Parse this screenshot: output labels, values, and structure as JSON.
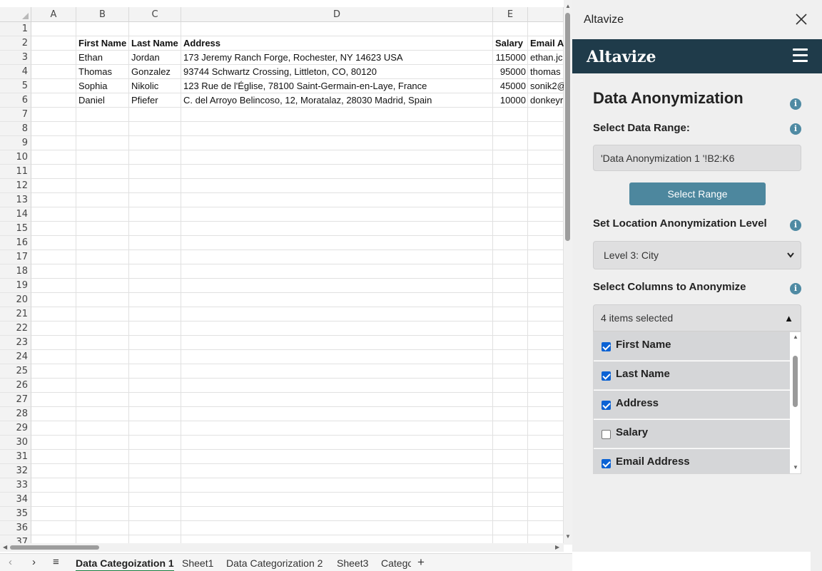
{
  "spreadsheet": {
    "corner": "",
    "columns": [
      "A",
      "B",
      "C",
      "D",
      "E"
    ],
    "rows": [
      "1",
      "2",
      "3",
      "4",
      "5",
      "6",
      "7",
      "8",
      "9",
      "10",
      "11",
      "12",
      "13",
      "14",
      "15",
      "16",
      "17",
      "18",
      "19",
      "20",
      "21",
      "22",
      "23",
      "24",
      "25",
      "26",
      "27",
      "28",
      "29",
      "30",
      "31",
      "32",
      "33",
      "34",
      "35",
      "36",
      "37"
    ],
    "header_row": {
      "first_name": "First Name",
      "last_name": "Last Name",
      "address": "Address",
      "salary": "Salary",
      "email": "Email Ad"
    },
    "data_rows": [
      {
        "first": "Ethan",
        "last": "Jordan",
        "address": "173 Jeremy Ranch Forge, Rochester, NY 14623 USA",
        "salary": "115000",
        "email": "ethan.jc"
      },
      {
        "first": "Thomas",
        "last": "Gonzalez",
        "address": "93744 Schwartz Crossing, Littleton, CO, 80120",
        "salary": "95000",
        "email": "thomas"
      },
      {
        "first": "Sophia",
        "last": "Nikolic",
        "address": "123 Rue de l'Église, 78100 Saint-Germain-en-Laye, France",
        "salary": "45000",
        "email": "sonik2@"
      },
      {
        "first": "Daniel",
        "last": "Pfiefer",
        "address": "C. del Arroyo Belincoso, 12, Moratalaz, 28030 Madrid, Spain",
        "salary": "10000",
        "email": "donkeyr"
      }
    ],
    "tabs": {
      "prev": "‹",
      "next": "›",
      "menu": "≡",
      "items": [
        "Data Categoization 1",
        "Sheet1",
        "Data Categorization 2",
        "Sheet3",
        "Catego"
      ],
      "active_index": 0,
      "add": "+"
    }
  },
  "pane": {
    "title": "Altavize",
    "close_icon": "close-icon",
    "brand": "Altavize",
    "heading": "Data Anonymization",
    "select_range_label": "Select Data Range:",
    "range_value": "'Data Anonymization 1 '!B2:K6",
    "select_range_button": "Select Range",
    "location_label": "Set Location Anonymization Level",
    "location_value": "Level 3: City",
    "columns_label": "Select Columns to Anonymize",
    "columns_summary": "4 items selected",
    "columns_toggle": "▲",
    "info_glyph": "i",
    "columns": [
      {
        "label": "First Name",
        "checked": true
      },
      {
        "label": "Last Name",
        "checked": true
      },
      {
        "label": "Address",
        "checked": true
      },
      {
        "label": "Salary",
        "checked": false
      },
      {
        "label": "Email Address",
        "checked": true
      }
    ]
  },
  "colors": {
    "brand_bar": "#1f3b4a",
    "button": "#4d879e",
    "info_icon": "#4f8aa3",
    "checkbox": "#0b62d4"
  }
}
